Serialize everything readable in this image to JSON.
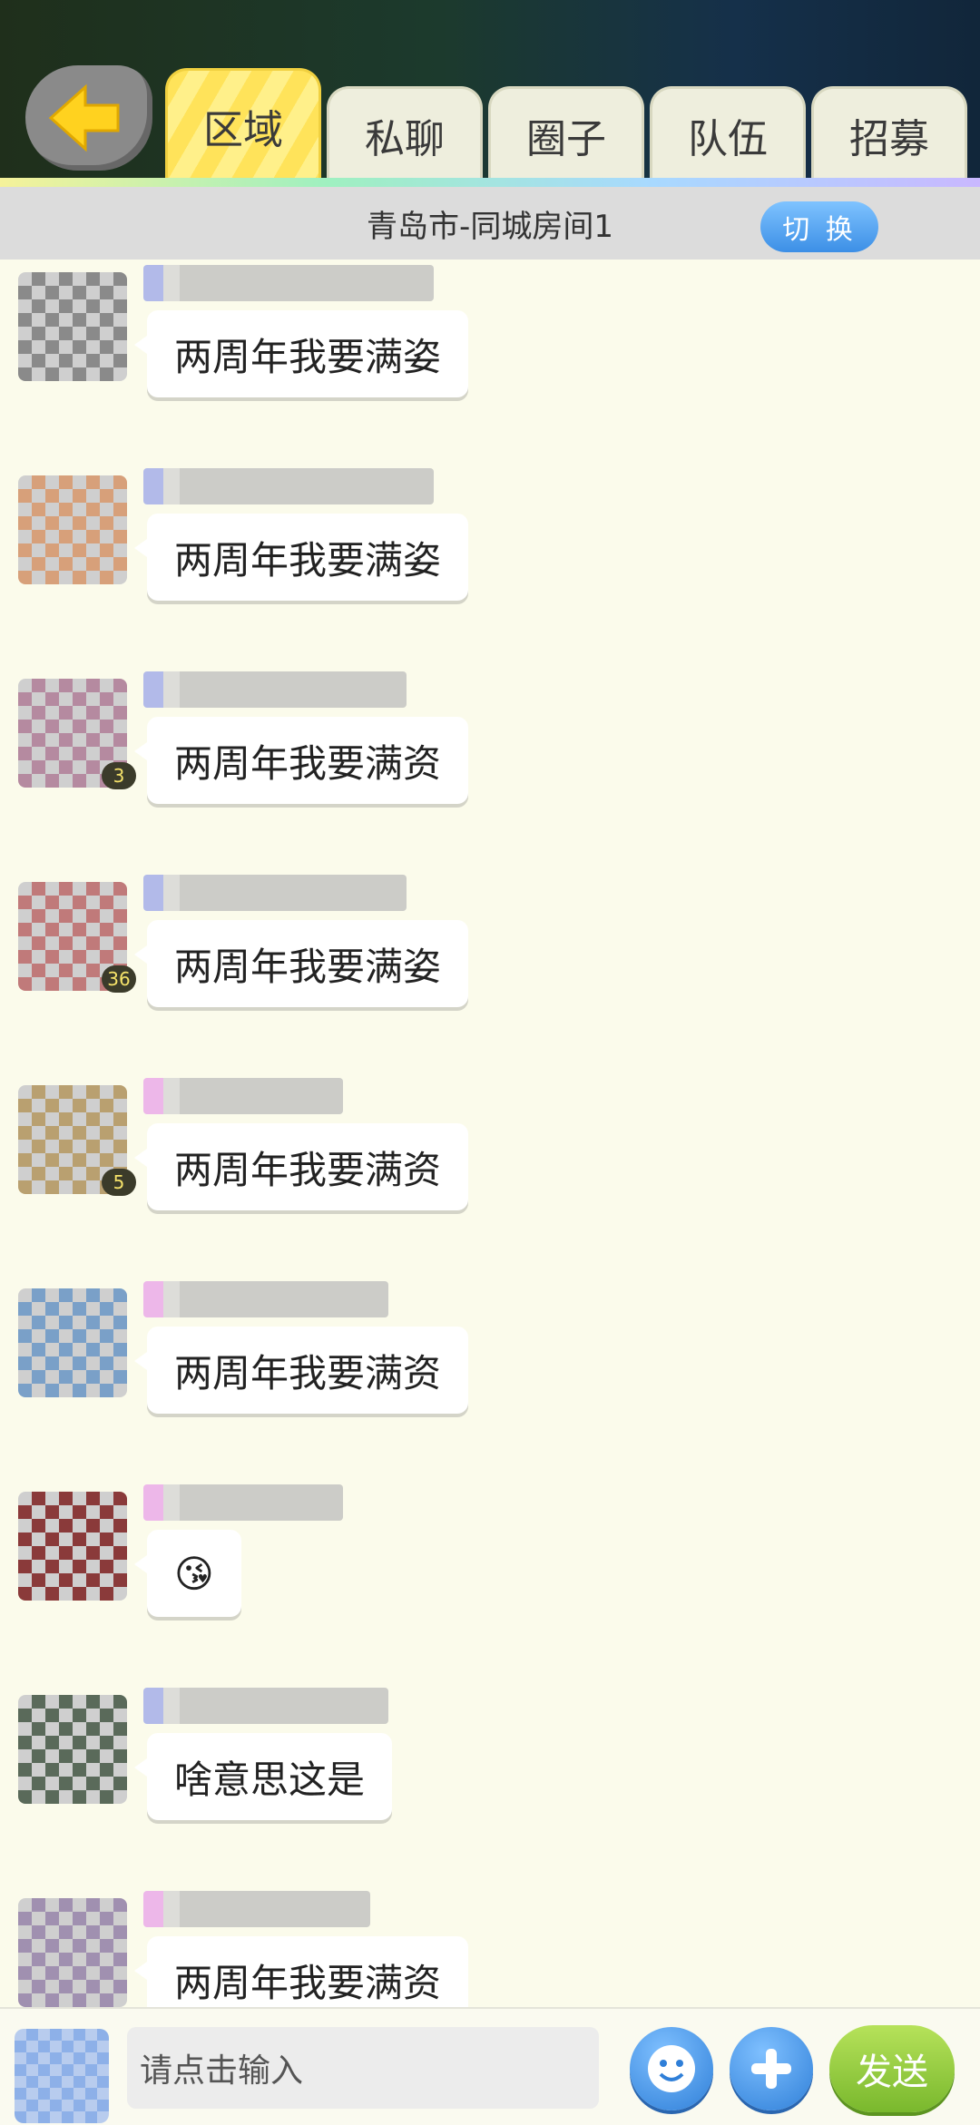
{
  "header": {
    "tabs": [
      {
        "label": "区域",
        "active": true
      },
      {
        "label": "私聊",
        "active": false
      },
      {
        "label": "圈子",
        "active": false
      },
      {
        "label": "队伍",
        "active": false
      },
      {
        "label": "招募",
        "active": false
      }
    ]
  },
  "room": {
    "title": "青岛市-同城房间1",
    "switch_label": "切 换"
  },
  "messages": [
    {
      "text": "两周年我要满姿",
      "level": "",
      "avatar_color": "#8a8a8a",
      "name_style": "blue"
    },
    {
      "text": "两周年我要满姿",
      "level": "",
      "avatar_color": "#d7a07a",
      "name_style": "blue"
    },
    {
      "text": "两周年我要满资",
      "level": "3",
      "avatar_color": "#b58aa0",
      "name_style": "blue"
    },
    {
      "text": "两周年我要满姿",
      "level": "36",
      "avatar_color": "#c07a7a",
      "name_style": "blue"
    },
    {
      "text": "两周年我要满资",
      "level": "5",
      "avatar_color": "#b9a070",
      "name_style": "pink"
    },
    {
      "text": "两周年我要满资",
      "level": "",
      "avatar_color": "#7aa0c8",
      "name_style": "pink"
    },
    {
      "text": "😘",
      "level": "",
      "avatar_color": "#8a3a3a",
      "name_style": "pink"
    },
    {
      "text": "啥意思这是",
      "level": "",
      "avatar_color": "#5a6a5a",
      "name_style": "blue"
    },
    {
      "text": "两周年我要满资",
      "level": "",
      "avatar_color": "#a090b0",
      "name_style": "pink"
    }
  ],
  "input": {
    "placeholder": "请点击输入",
    "send_label": "发送"
  },
  "icons": {
    "back": "back-arrow-icon",
    "emoji": "smiley-icon",
    "plus": "plus-icon"
  },
  "colors": {
    "accent_yellow": "#ffe35a",
    "button_blue": "#3c8fe6",
    "send_green": "#79b82d"
  }
}
